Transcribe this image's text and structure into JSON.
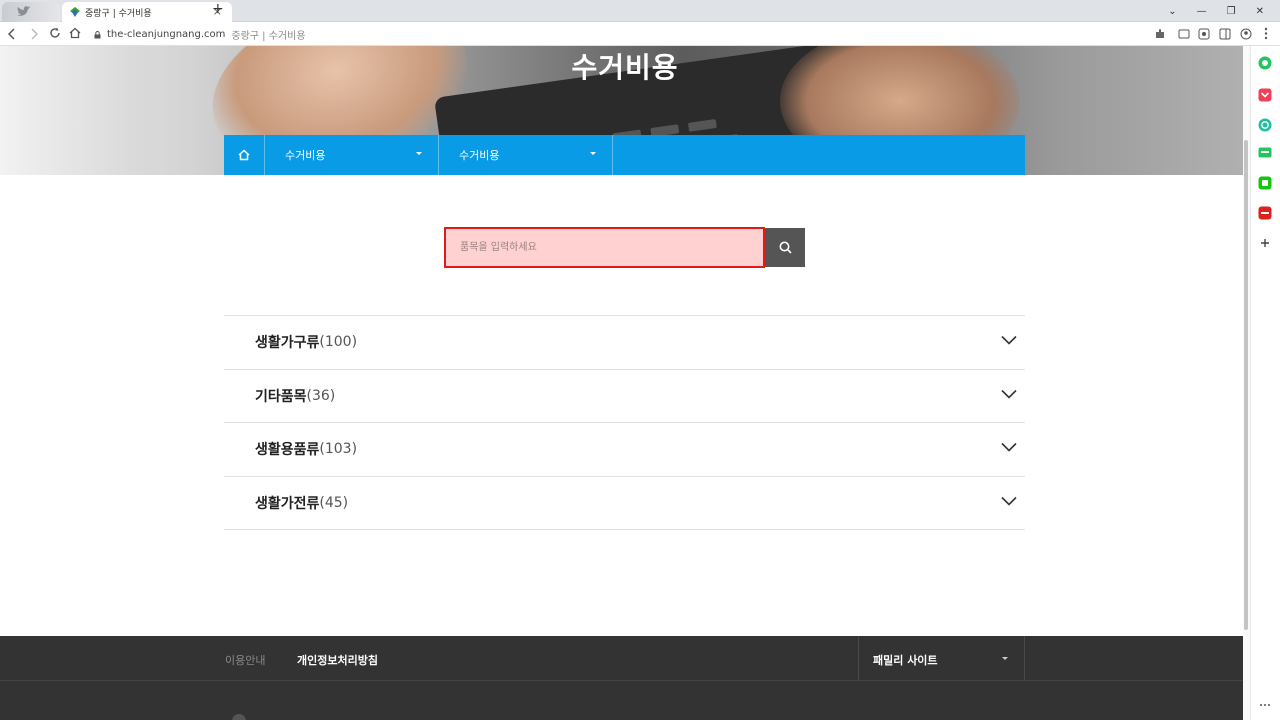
{
  "browser": {
    "tab_title": "중랑구 | 수거비용",
    "tab_close": "×",
    "new_tab": "+",
    "url_domain": "the-cleanjungnang.com",
    "url_title": "중랑구 | 수거비용",
    "window_controls": [
      "⌄",
      "—",
      "❐",
      "✕"
    ]
  },
  "hero": {
    "title": "수거비용"
  },
  "subnav": {
    "items": [
      {
        "label": "수거비용"
      },
      {
        "label": "수거비용"
      }
    ]
  },
  "search": {
    "placeholder": "품목을 입력하세요",
    "value": ""
  },
  "categories": [
    {
      "label": "생활가구류",
      "count": "(100)"
    },
    {
      "label": "기타품목",
      "count": "(36)"
    },
    {
      "label": "생활용품류",
      "count": "(103)"
    },
    {
      "label": "생활가전류",
      "count": "(45)"
    }
  ],
  "footer": {
    "link1": "이용안내",
    "link2": "개인정보처리방침",
    "family_site": "패밀리 사이트"
  },
  "sidebar_icons": [
    "circle-icon",
    "pocket-icon",
    "refresh-icon",
    "chat-icon",
    "line-icon",
    "news-icon",
    "add-icon"
  ],
  "colors": {
    "subnav_bg": "#0a9be6",
    "search_highlight": "#e01b1b",
    "footer_bg": "#333333"
  }
}
